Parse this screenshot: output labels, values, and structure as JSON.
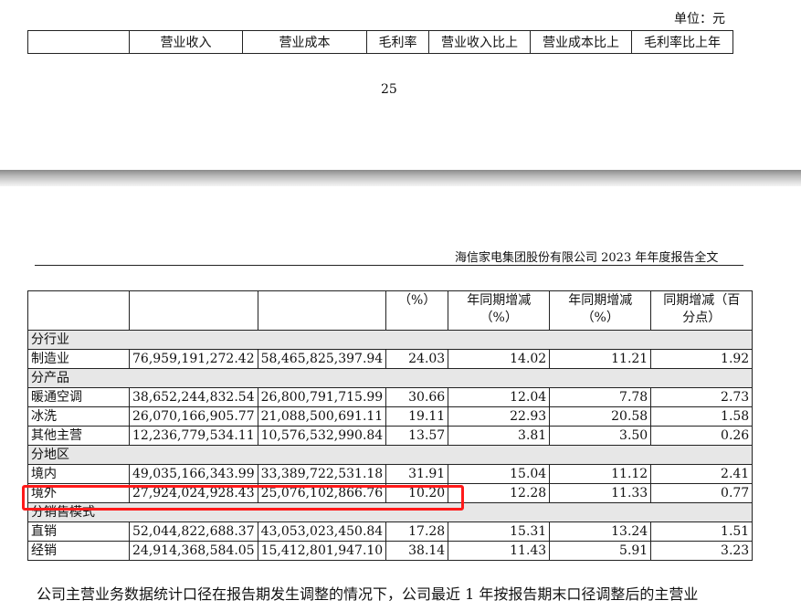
{
  "unit_label": "单位：元",
  "header_row": [
    "",
    "营业收入",
    "营业成本",
    "毛利率",
    "营业收入比上",
    "营业成本比上",
    "毛利率比上年"
  ],
  "page_number": "25",
  "running_head": "海信家电集团股份有限公司 2023 年年度报告全文",
  "table_header": {
    "col_margin": "（%）",
    "col_rev_change": [
      "年同期增减",
      "（%）"
    ],
    "col_cost_change": [
      "年同期增减",
      "（%）"
    ],
    "col_margin_change": [
      "同期增减（百",
      "分点）"
    ]
  },
  "sections": [
    {
      "group": "分行业",
      "rows": [
        [
          "制造业",
          "76,959,191,272.42",
          "58,465,825,397.94",
          "24.03",
          "14.02",
          "11.21",
          "1.92"
        ]
      ]
    },
    {
      "group": "分产品",
      "rows": [
        [
          "暖通空调",
          "38,652,244,832.54",
          "26,800,791,715.99",
          "30.66",
          "12.04",
          "7.78",
          "2.73"
        ],
        [
          "冰洗",
          "26,070,166,905.77",
          "21,088,500,691.11",
          "19.11",
          "22.93",
          "20.58",
          "1.58"
        ],
        [
          "其他主营",
          "12,236,779,534.11",
          "10,576,532,990.84",
          "13.57",
          "3.81",
          "3.50",
          "0.26"
        ]
      ]
    },
    {
      "group": "分地区",
      "rows": [
        [
          "境内",
          "49,035,166,343.99",
          "33,389,722,531.18",
          "31.91",
          "15.04",
          "11.12",
          "2.41"
        ],
        [
          "境外",
          "27,924,024,928.43",
          "25,076,102,866.76",
          "10.20",
          "12.28",
          "11.33",
          "0.77"
        ]
      ]
    },
    {
      "group": "分销售模式",
      "rows": [
        [
          "直销",
          "52,044,822,688.37",
          "43,053,023,450.84",
          "17.28",
          "15.31",
          "13.24",
          "1.51"
        ],
        [
          "经销",
          "24,914,368,584.05",
          "15,412,801,947.10",
          "38.14",
          "11.43",
          "5.91",
          "3.23"
        ]
      ]
    }
  ],
  "highlight_color": "#ff1a1a",
  "paragraph": "公司主营业务数据统计口径在报告期发生调整的情况下，公司最近 1 年按报告期末口径调整后的主营业"
}
